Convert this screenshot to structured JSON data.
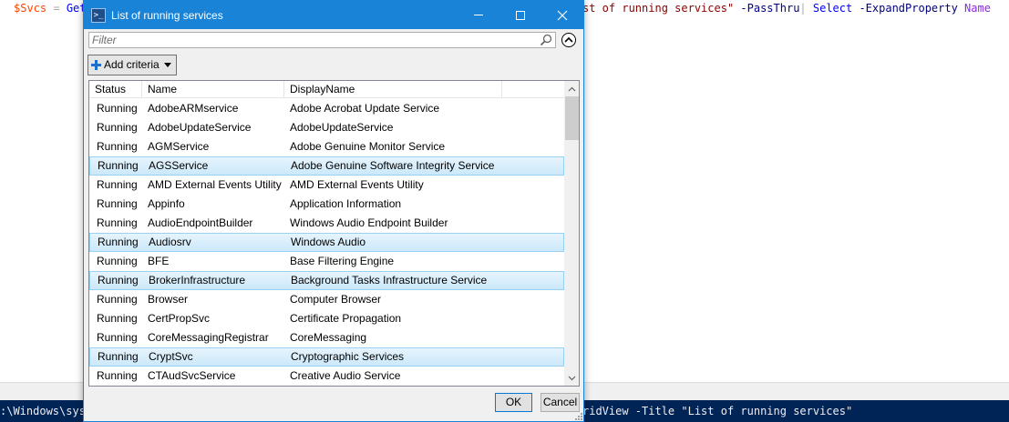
{
  "editor": {
    "left_segments": {
      "var": "$Svcs",
      "op": " = ",
      "cmd": "Get"
    },
    "right_segments": {
      "str": "st of running services\"",
      "param": " -PassThru",
      "pipe": "|",
      "cmd": " Select",
      "param2": " -ExpandProperty",
      "value": " Name"
    }
  },
  "console": {
    "left_text": ":\\Windows\\sys",
    "right_text": "ridView -Title \"List of running services\""
  },
  "dialog": {
    "title": "List of running services",
    "filter_placeholder": "Filter",
    "add_criteria_label": "Add criteria",
    "columns": [
      "Status",
      "Name",
      "DisplayName",
      ""
    ],
    "rows": [
      {
        "status": "Running",
        "name": "AdobeARMservice",
        "display": "Adobe Acrobat Update Service",
        "selected": false
      },
      {
        "status": "Running",
        "name": "AdobeUpdateService",
        "display": "AdobeUpdateService",
        "selected": false
      },
      {
        "status": "Running",
        "name": "AGMService",
        "display": "Adobe Genuine Monitor Service",
        "selected": false
      },
      {
        "status": "Running",
        "name": "AGSService",
        "display": "Adobe Genuine Software Integrity Service",
        "selected": true
      },
      {
        "status": "Running",
        "name": "AMD External Events Utility",
        "display": "AMD External Events Utility",
        "selected": false
      },
      {
        "status": "Running",
        "name": "Appinfo",
        "display": "Application Information",
        "selected": false
      },
      {
        "status": "Running",
        "name": "AudioEndpointBuilder",
        "display": "Windows Audio Endpoint Builder",
        "selected": false
      },
      {
        "status": "Running",
        "name": "Audiosrv",
        "display": "Windows Audio",
        "selected": true
      },
      {
        "status": "Running",
        "name": "BFE",
        "display": "Base Filtering Engine",
        "selected": false
      },
      {
        "status": "Running",
        "name": "BrokerInfrastructure",
        "display": "Background Tasks Infrastructure Service",
        "selected": true
      },
      {
        "status": "Running",
        "name": "Browser",
        "display": "Computer Browser",
        "selected": false
      },
      {
        "status": "Running",
        "name": "CertPropSvc",
        "display": "Certificate Propagation",
        "selected": false
      },
      {
        "status": "Running",
        "name": "CoreMessagingRegistrar",
        "display": "CoreMessaging",
        "selected": false
      },
      {
        "status": "Running",
        "name": "CryptSvc",
        "display": "Cryptographic Services",
        "selected": true
      },
      {
        "status": "Running",
        "name": "CTAudSvcService",
        "display": "Creative Audio Service",
        "selected": false
      }
    ],
    "ok_label": "OK",
    "cancel_label": "Cancel"
  },
  "icons": {
    "app": "powershell-icon",
    "search": "search-icon",
    "collapse": "chevron-up-circle-icon",
    "add": "plus-icon",
    "dropdown": "caret-down-icon"
  },
  "colors": {
    "titlebar": "#1883d7",
    "selection": "#cce8fa",
    "console_bg": "#012456"
  }
}
